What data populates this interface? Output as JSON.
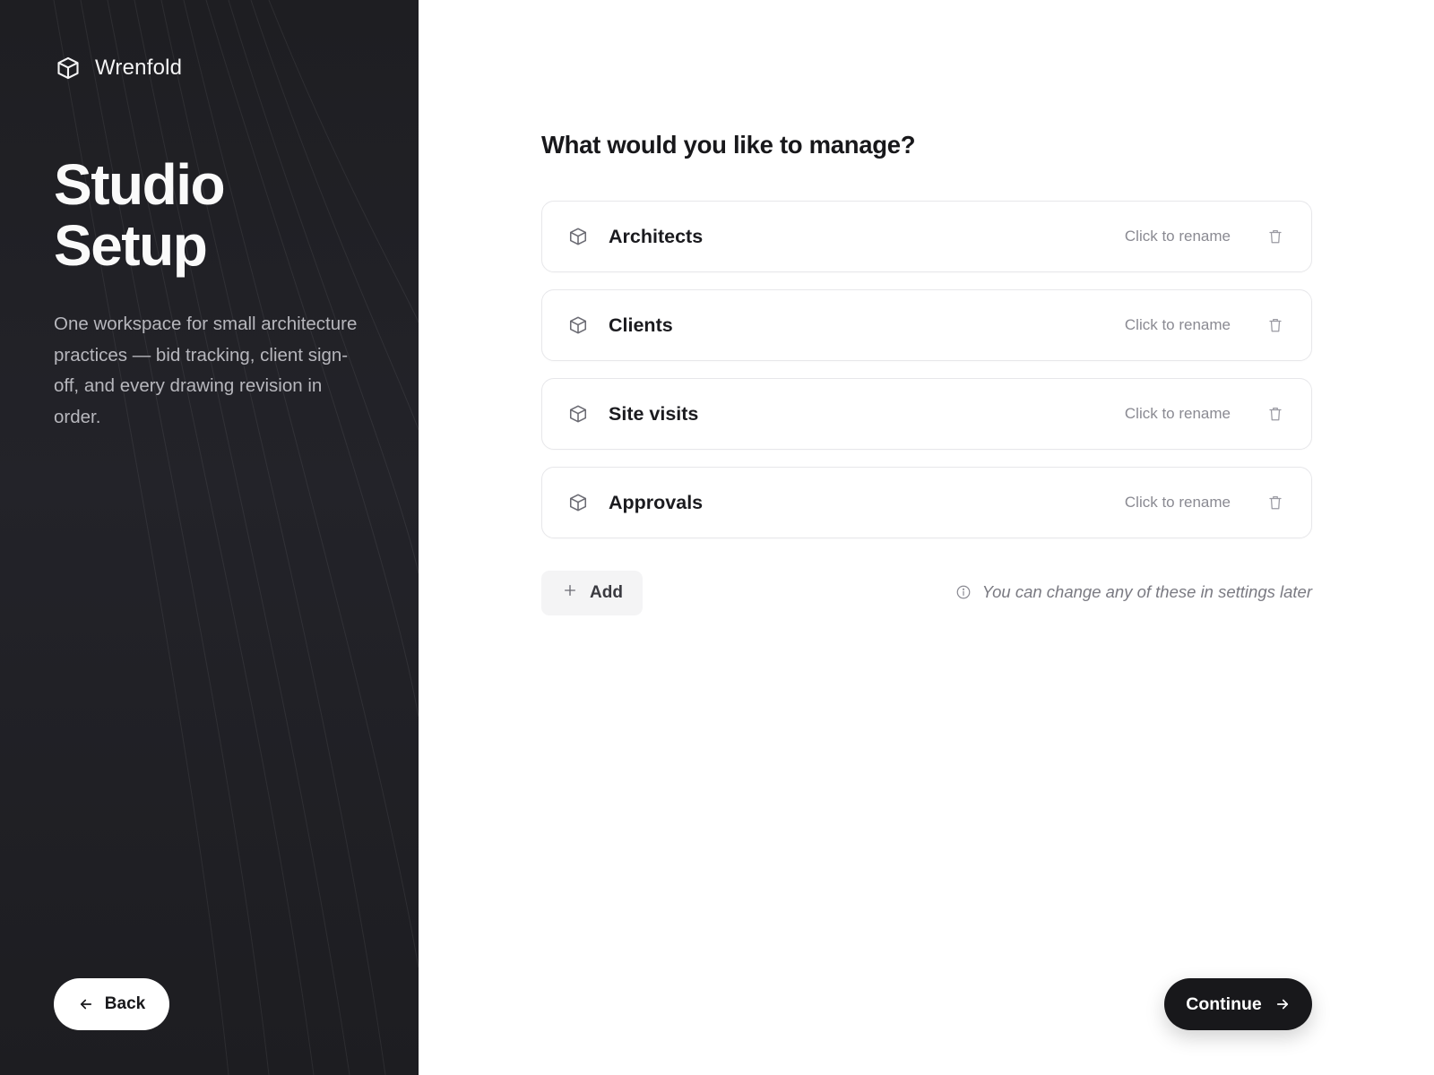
{
  "brand": {
    "name": "Wrenfold",
    "icon": "cube-icon"
  },
  "hero": {
    "title_line1": "Studio",
    "title_line2": "Setup",
    "description": "One workspace for small architecture practices — bid tracking, client sign-off, and every drawing revision in order."
  },
  "main": {
    "question": "What would you like to manage?",
    "items": [
      {
        "label": "Architects",
        "rename_hint": "Click to rename",
        "icon": "cube-icon",
        "action_icon": "trash-icon"
      },
      {
        "label": "Clients",
        "rename_hint": "Click to rename",
        "icon": "cube-icon",
        "action_icon": "trash-icon"
      },
      {
        "label": "Site visits",
        "rename_hint": "Click to rename",
        "icon": "cube-icon",
        "action_icon": "trash-icon"
      },
      {
        "label": "Approvals",
        "rename_hint": "Click to rename",
        "icon": "cube-icon",
        "action_icon": "trash-icon"
      }
    ],
    "add_label": "Add",
    "hint": "You can change any of these in settings later"
  },
  "nav": {
    "back_label": "Back",
    "continue_label": "Continue"
  },
  "colors": {
    "panel_dark": "#1e1e22",
    "primary_button": "#18181b",
    "muted_text": "#8a8a92",
    "border": "#e7e7ea"
  }
}
